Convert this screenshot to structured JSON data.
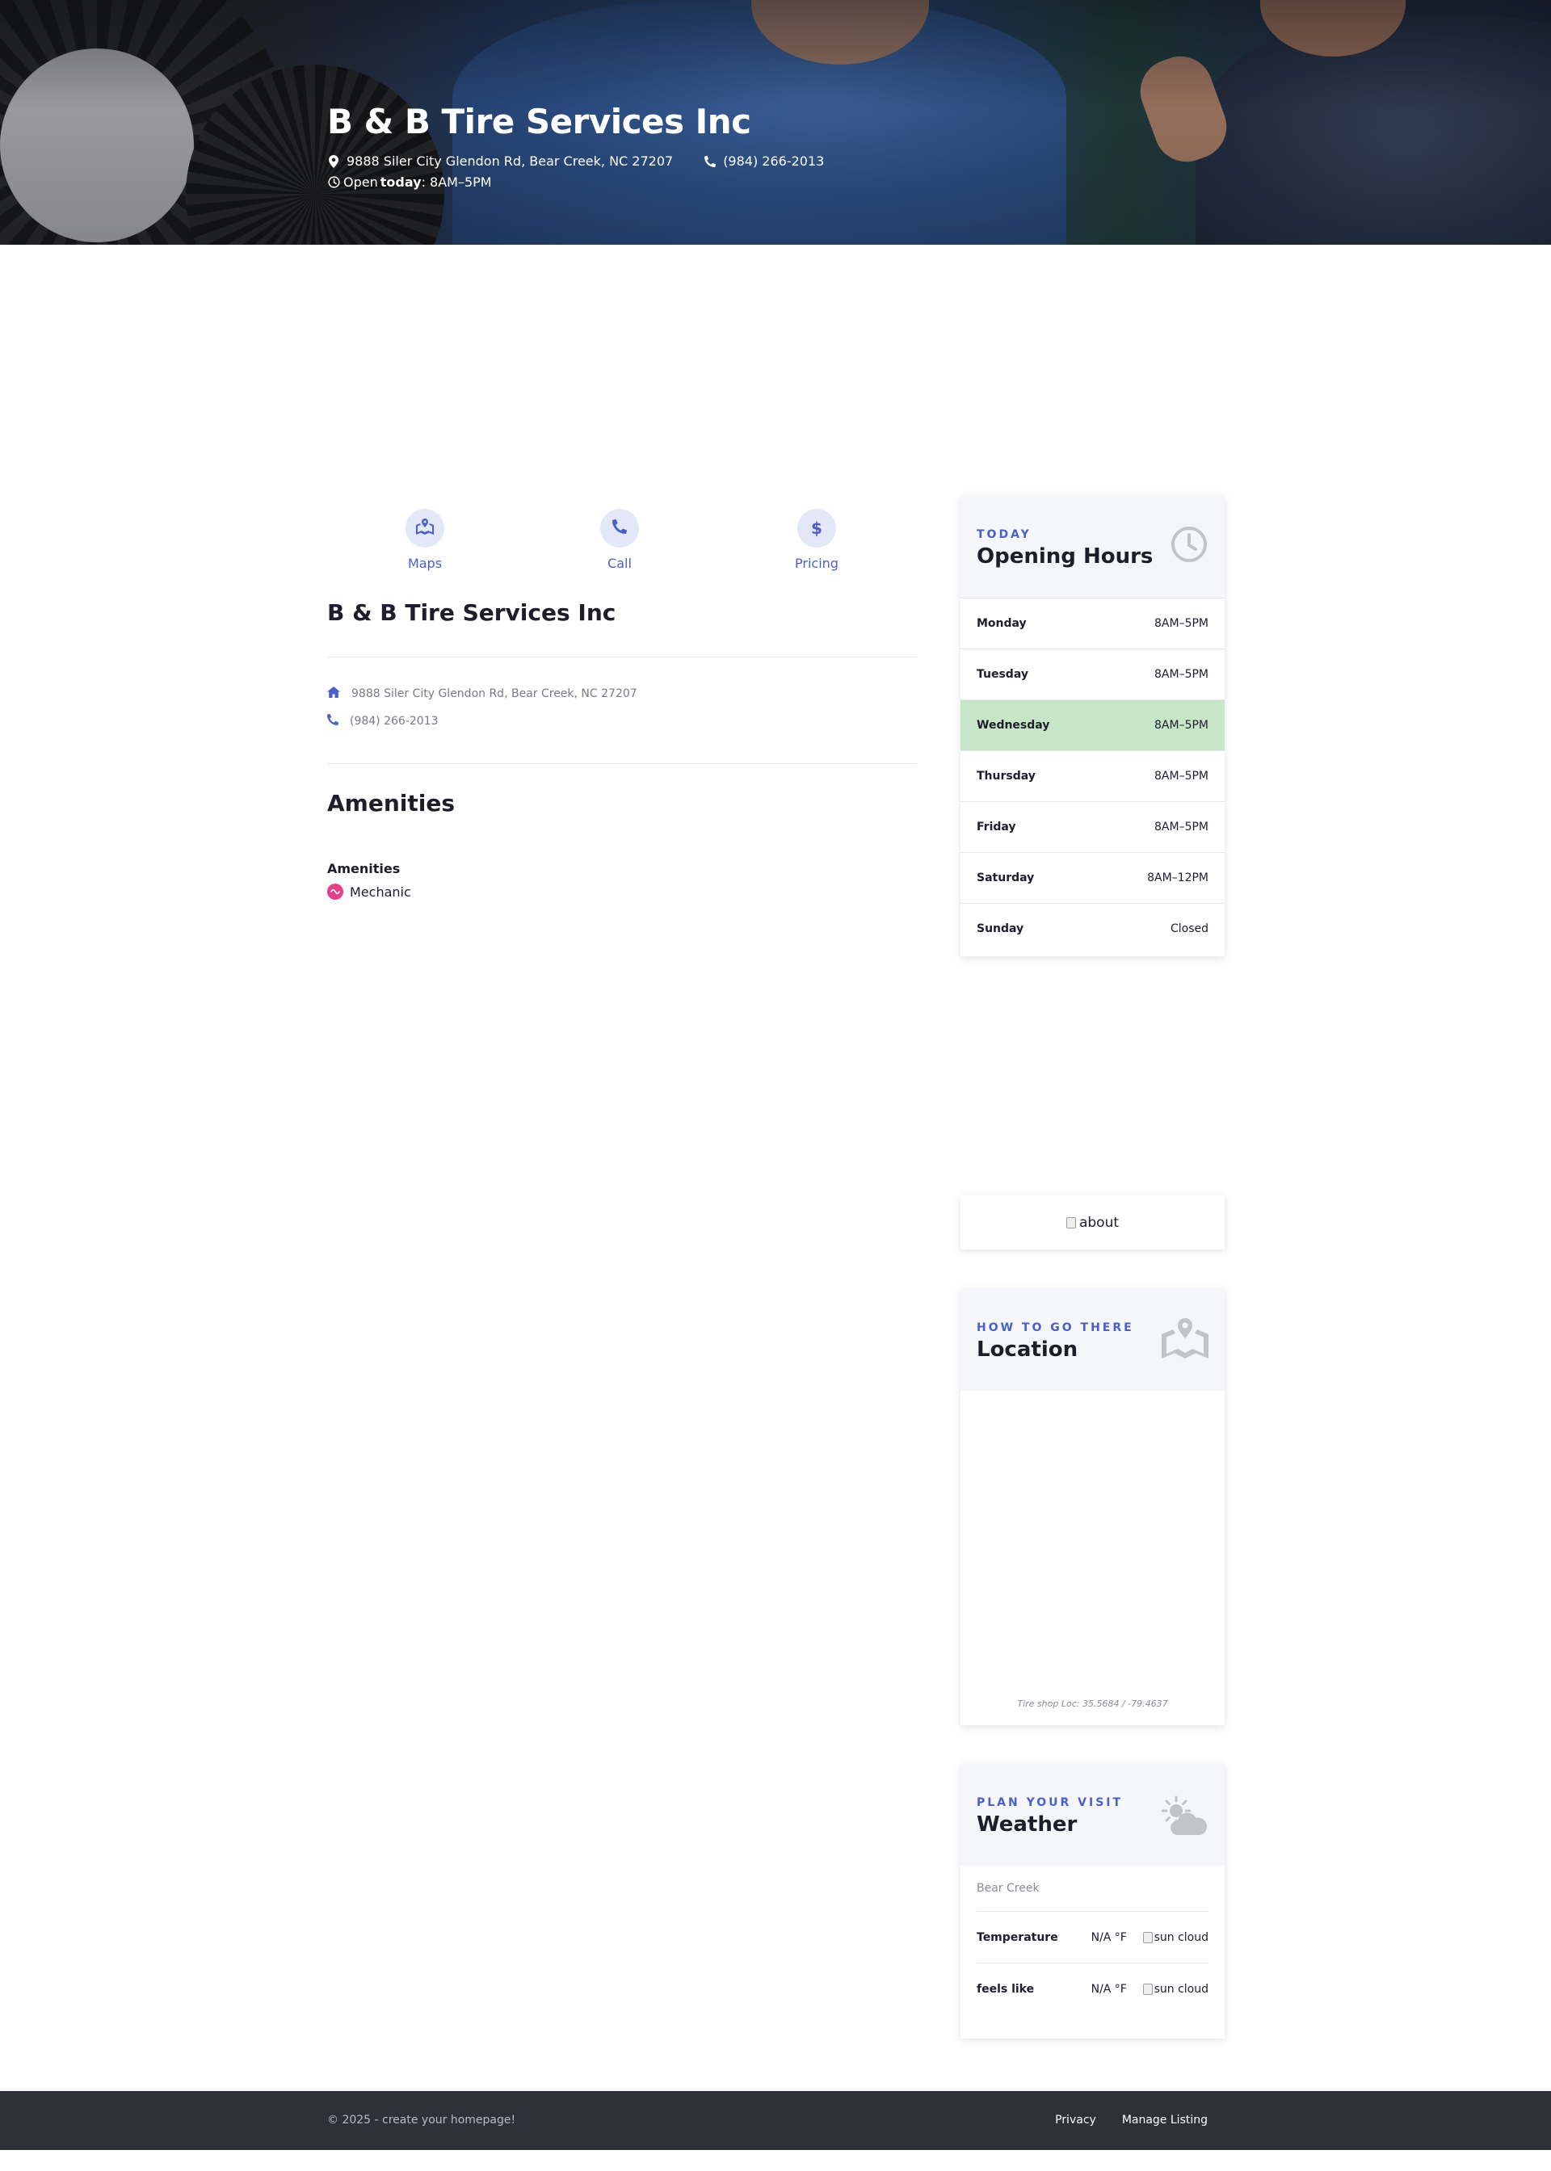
{
  "hero": {
    "title": "B & B Tire Services Inc",
    "address": "9888 Siler City Glendon Rd, Bear Creek, NC 27207",
    "phone": "(984) 266-2013",
    "open_prefix": "Open",
    "open_today": "today",
    "open_hours": ": 8AM–5PM"
  },
  "actions": {
    "maps": "Maps",
    "call": "Call",
    "pricing": "Pricing"
  },
  "business": {
    "name": "B & B Tire Services Inc",
    "address": "9888 Siler City Glendon Rd, Bear Creek, NC 27207",
    "phone": "(984) 266-2013"
  },
  "amenities": {
    "heading": "Amenities",
    "subheading": "Amenities",
    "items": [
      "Mechanic"
    ]
  },
  "hours": {
    "eyebrow": "TODAY",
    "title": "Opening Hours",
    "days": [
      {
        "day": "Monday",
        "time": "8AM–5PM"
      },
      {
        "day": "Tuesday",
        "time": "8AM–5PM"
      },
      {
        "day": "Wednesday",
        "time": "8AM–5PM",
        "today": true
      },
      {
        "day": "Thursday",
        "time": "8AM–5PM"
      },
      {
        "day": "Friday",
        "time": "8AM–5PM"
      },
      {
        "day": "Saturday",
        "time": "8AM–12PM"
      },
      {
        "day": "Sunday",
        "time": "Closed"
      }
    ],
    "today_color": "#c6e6c7"
  },
  "about": {
    "alt": "about"
  },
  "location": {
    "eyebrow": "HOW TO GO THERE",
    "title": "Location",
    "coords": "Tire shop Loc: 35.5684 / -79.4637"
  },
  "weather": {
    "eyebrow": "PLAN YOUR VISIT",
    "title": "Weather",
    "city": "Bear Creek",
    "rows": [
      {
        "label": "Temperature",
        "value": "N/A °F",
        "img_alt": "sun cloud"
      },
      {
        "label": "feels like",
        "value": "N/A °F",
        "img_alt": "sun cloud"
      }
    ]
  },
  "footer": {
    "copyright": "© 2025 - create your homepage!",
    "links": [
      "Privacy",
      "Manage Listing"
    ]
  },
  "colors": {
    "accent": "#4a5fc9",
    "footer_bg": "#2f3138",
    "amenity_dot": "#e0418a"
  },
  "icons": {
    "address": "map-pin-icon",
    "phone": "phone-icon",
    "clock": "clock-icon",
    "maps": "map-marked-icon",
    "call": "phone-icon",
    "pricing": "dollar-icon",
    "home": "home-icon",
    "amenity": "amenity-icon",
    "hours_header": "clock-icon",
    "location_header": "map-icon",
    "weather_header": "sun-cloud-icon"
  }
}
